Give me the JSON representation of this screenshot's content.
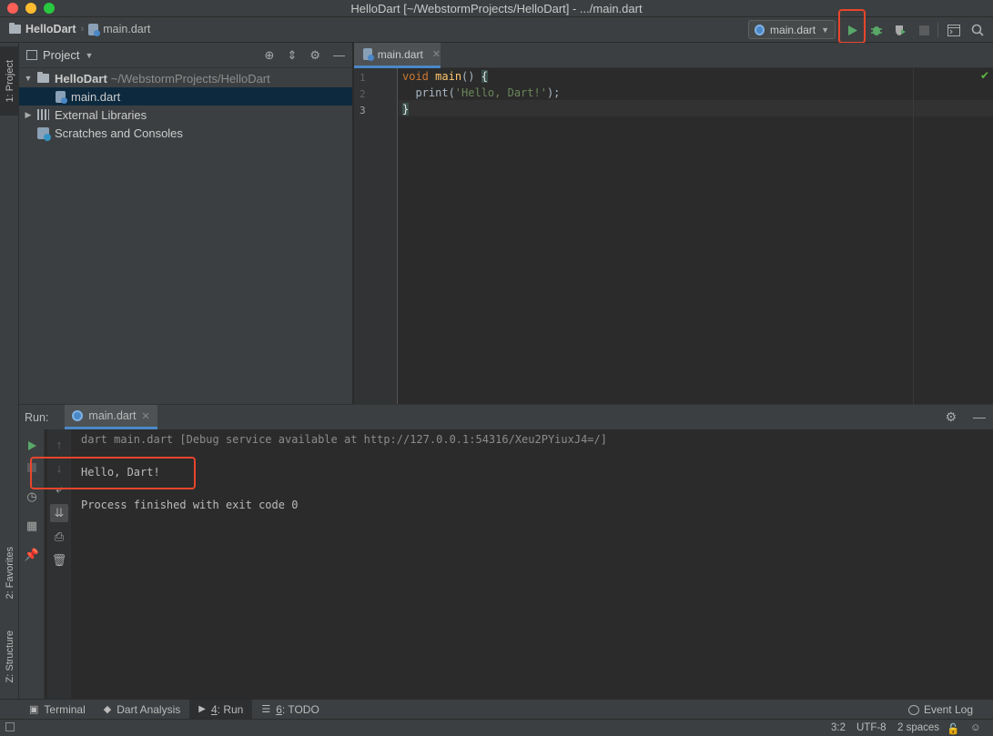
{
  "window": {
    "title": "HelloDart [~/WebstormProjects/HelloDart] - .../main.dart",
    "traffic_light_colors": [
      "#fe5f57",
      "#febc2e",
      "#28c840"
    ]
  },
  "navbar": {
    "project_name": "HelloDart",
    "file_name": "main.dart",
    "run_config": "main.dart",
    "icons": [
      "run-icon",
      "debug-icon",
      "coverage-icon",
      "stop-icon",
      "terminal-icon",
      "search-icon"
    ]
  },
  "left_stripe": {
    "project_tab": "1: Project",
    "favorites_tab": "2: Favorites",
    "structure_tab": "Z: Structure"
  },
  "project_panel": {
    "title": "Project",
    "tree": {
      "root_name": "HelloDart",
      "root_path": "~/WebstormProjects/HelloDart",
      "file": "main.dart",
      "external_libraries": "External Libraries",
      "scratches": "Scratches and Consoles"
    }
  },
  "editor": {
    "tab_label": "main.dart",
    "line_numbers": [
      "1",
      "2",
      "3"
    ],
    "code": {
      "l1_kw": "void",
      "l1_fn": "main",
      "l1_rest": "() ",
      "l1_brace": "{",
      "l2_indent": "  print(",
      "l2_str": "'Hello, Dart!'",
      "l2_end": ");",
      "l3_brace": "}"
    }
  },
  "run_panel": {
    "label": "Run:",
    "tab_label": "main.dart",
    "console": {
      "command": "dart main.dart [Debug service available at http://127.0.0.1:54316/Xeu2PYiuxJ4=/]",
      "output": "Hello, Dart!",
      "finish": "Process finished with exit code 0"
    }
  },
  "bottom_tools": {
    "terminal": "Terminal",
    "dart_analysis": "Dart Analysis",
    "run_num": "4",
    "run_label": ": Run",
    "todo_num": "6",
    "todo_label": ": TODO",
    "event_log": "Event Log"
  },
  "status": {
    "position": "3:2",
    "encoding": "UTF-8",
    "indent": "2 spaces"
  },
  "colors": {
    "accent": "#4a88c7",
    "highlight": "#e8452c",
    "run_green": "#59a869",
    "selection": "#0d293e"
  }
}
